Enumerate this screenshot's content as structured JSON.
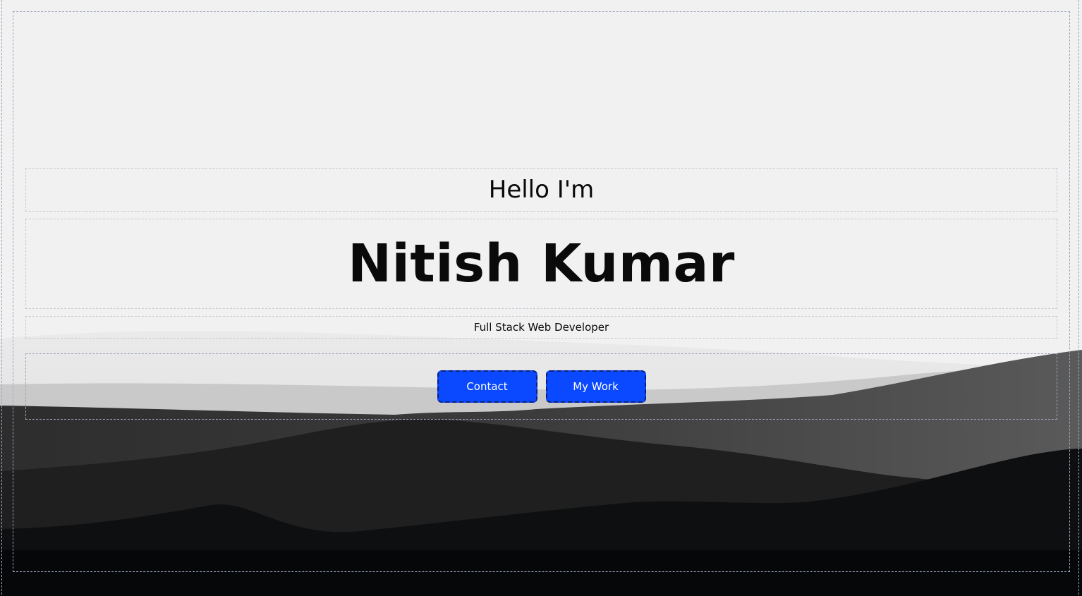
{
  "hero": {
    "greeting": "Hello I'm",
    "name": "Nitish Kumar",
    "role": "Full Stack Web Developer"
  },
  "buttons": {
    "contact_label": "Contact",
    "work_label": "My Work"
  },
  "colors": {
    "background": "#f1f1f1",
    "button_bg": "#0a49ff",
    "button_text": "#ffffff",
    "text": "#0a0a0a"
  }
}
